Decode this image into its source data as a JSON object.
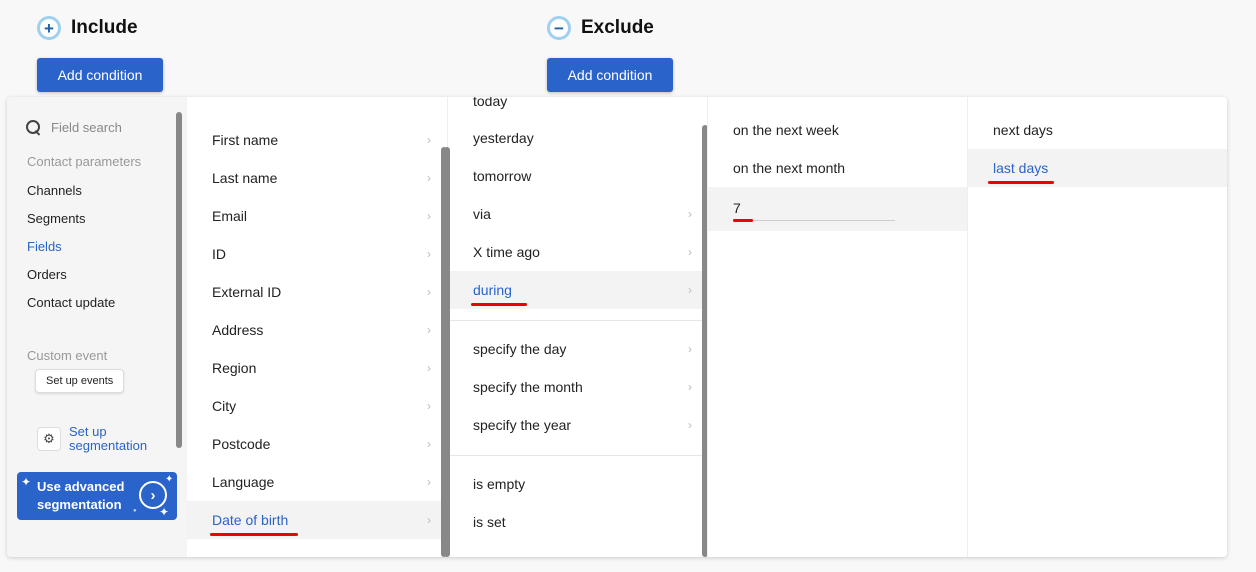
{
  "include": {
    "title": "Include",
    "icon": "plus-icon",
    "icon_glyph": "+",
    "add_label": "Add condition"
  },
  "exclude": {
    "title": "Exclude",
    "icon": "minus-icon",
    "icon_glyph": "−",
    "add_label": "Add condition"
  },
  "sidebar": {
    "search_placeholder": "Field search",
    "section_contact": "Contact parameters",
    "items": [
      {
        "label": "Channels",
        "active": false
      },
      {
        "label": "Segments",
        "active": false
      },
      {
        "label": "Fields",
        "active": true
      },
      {
        "label": "Orders",
        "active": false
      },
      {
        "label": "Contact update",
        "active": false
      }
    ],
    "section_custom": "Custom event",
    "setup_events_label": "Set up events",
    "setup_segmentation_line1": "Set up",
    "setup_segmentation_line2": "segmentation",
    "advanced_line1": "Use advanced",
    "advanced_line2": "segmentation"
  },
  "fields": [
    {
      "label": "First name"
    },
    {
      "label": "Last name"
    },
    {
      "label": "Email"
    },
    {
      "label": "ID"
    },
    {
      "label": "External ID"
    },
    {
      "label": "Address"
    },
    {
      "label": "Region"
    },
    {
      "label": "City"
    },
    {
      "label": "Postcode"
    },
    {
      "label": "Language"
    },
    {
      "label": "Date of birth",
      "selected": true
    }
  ],
  "operators": {
    "group1": [
      {
        "label": "today",
        "chevron": false
      },
      {
        "label": "yesterday",
        "chevron": false
      },
      {
        "label": "tomorrow",
        "chevron": false
      },
      {
        "label": "via",
        "chevron": true
      },
      {
        "label": "X time ago",
        "chevron": true
      },
      {
        "label": "during",
        "chevron": true,
        "selected": true
      }
    ],
    "group2": [
      {
        "label": "specify the day",
        "chevron": true
      },
      {
        "label": "specify the month",
        "chevron": true
      },
      {
        "label": "specify the year",
        "chevron": true
      }
    ],
    "group3": [
      {
        "label": "is empty"
      },
      {
        "label": "is set"
      }
    ]
  },
  "during_options": [
    {
      "label": "on the next week"
    },
    {
      "label": "on the next month"
    }
  ],
  "during_value": "7",
  "day_direction": [
    {
      "label": "next days"
    },
    {
      "label": "last days",
      "selected": true
    }
  ],
  "colors": {
    "accent": "#2a63c9",
    "highlight_underline": "#e00000"
  }
}
